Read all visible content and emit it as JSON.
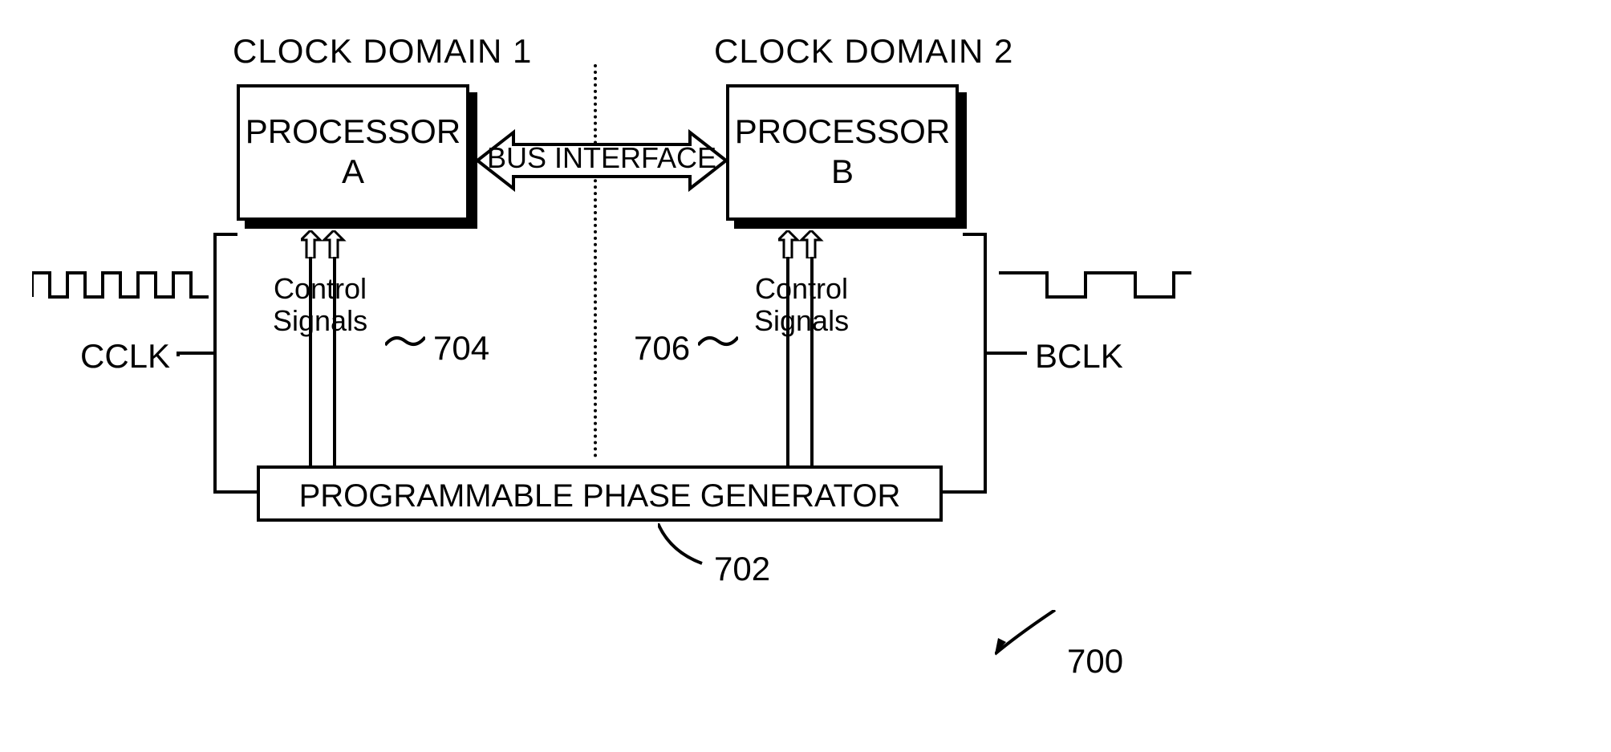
{
  "domain1": "CLOCK DOMAIN 1",
  "domain2": "CLOCK DOMAIN 2",
  "processorA": {
    "line1": "PROCESSOR",
    "line2": "A"
  },
  "processorB": {
    "line1": "PROCESSOR",
    "line2": "B"
  },
  "bus": "BUS INTERFACE",
  "cclk": "CCLK",
  "bclk": "BCLK",
  "control": {
    "line1": "Control",
    "line2": "Signals"
  },
  "pgen": "PROGRAMMABLE PHASE GENERATOR",
  "ref702": "702",
  "ref704": "704",
  "ref706": "706",
  "ref700": "700"
}
